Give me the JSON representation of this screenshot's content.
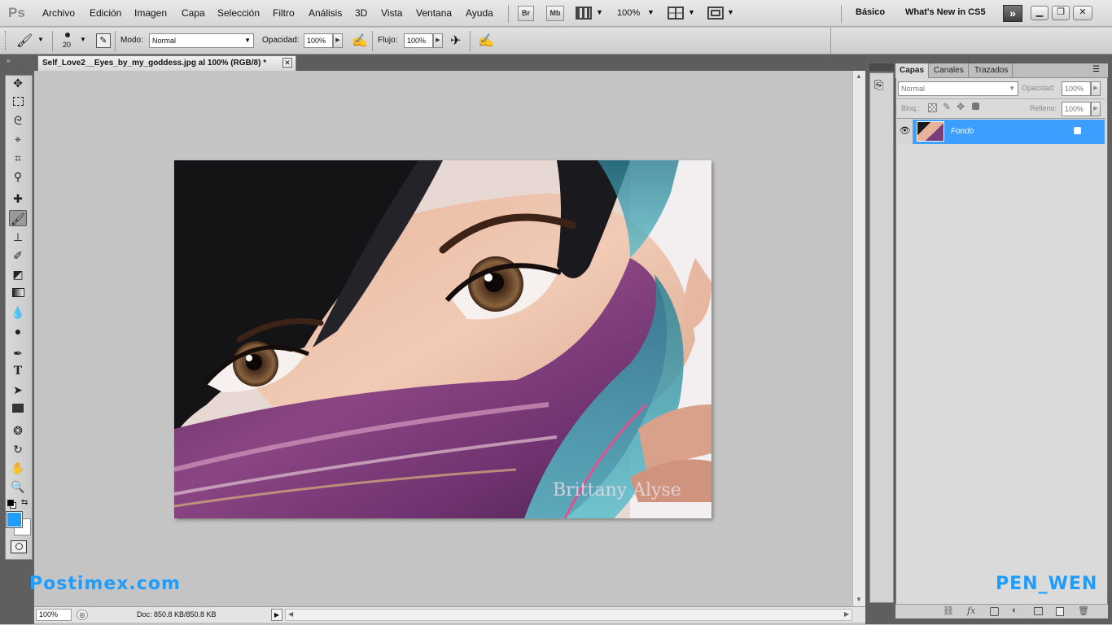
{
  "app": {
    "logo": "Ps"
  },
  "menu": {
    "items": [
      "Archivo",
      "Edición",
      "Imagen",
      "Capa",
      "Selección",
      "Filtro",
      "Análisis",
      "3D",
      "Vista",
      "Ventana",
      "Ayuda"
    ],
    "bridge_label": "Br",
    "minibridge_label": "Mb",
    "zoom": "100%",
    "workspace": "Básico",
    "whats_new": "What's New in CS5"
  },
  "options": {
    "brush_size": "20",
    "mode_label": "Modo:",
    "mode_value": "Normal",
    "opacity_label": "Opacidad:",
    "opacity_value": "100%",
    "flow_label": "Flujo:",
    "flow_value": "100%"
  },
  "document": {
    "tab_title": "Self_Love2__Eyes_by_my_goddess.jpg al 100% (RGB/8) *",
    "photo_signature": "Brittany Alyse",
    "status_zoom": "100%",
    "status_doc": "Doc: 850.8 KB/850.8 KB"
  },
  "layers_panel": {
    "tabs": [
      "Capas",
      "Canales",
      "Trazados"
    ],
    "blend_mode": "Normal",
    "opacity_label": "Opacidad:",
    "opacity_value": "100%",
    "lock_label": "Bloq.:",
    "fill_label": "Relleno:",
    "fill_value": "100%",
    "layer_name": "Fondo"
  },
  "watermarks": {
    "left": "Postimex.com",
    "right": "PEN_WEN"
  },
  "colors": {
    "foreground": "#1e9dff",
    "background": "#ffffff",
    "selected_layer": "#3c9fff"
  }
}
